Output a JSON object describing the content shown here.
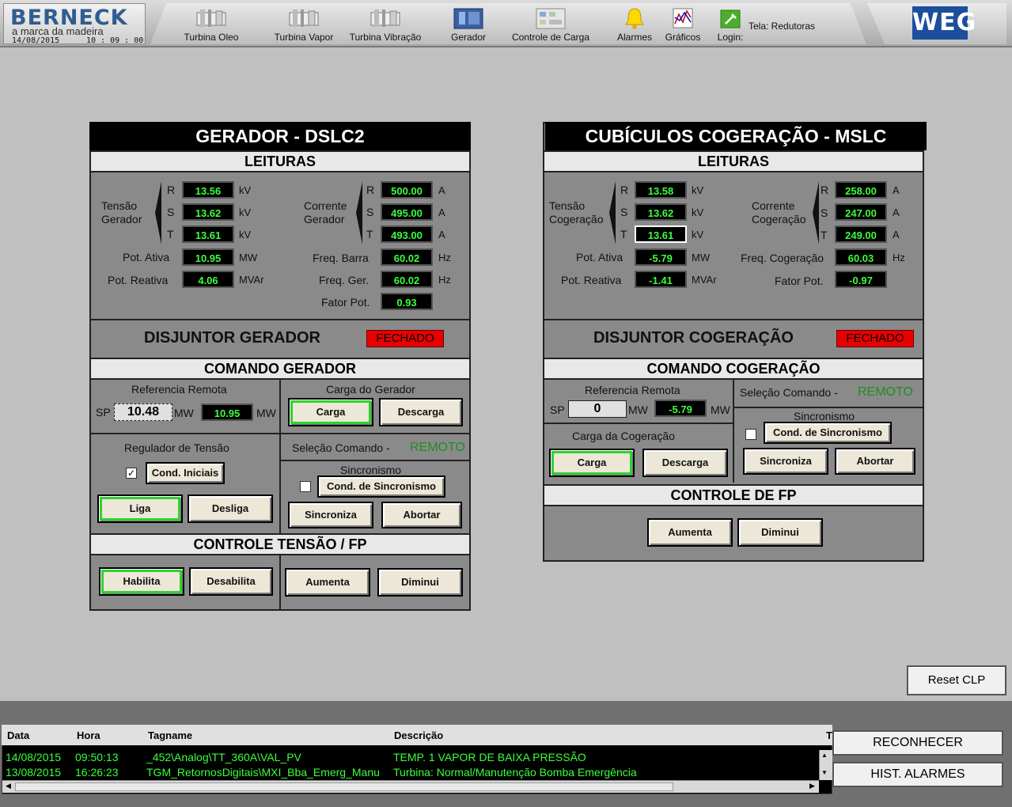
{
  "header": {
    "brand": "BERNECK",
    "tagline": "a marca da madeira",
    "date": "14/08/2015",
    "time": "10 : 09 : 00",
    "nav": [
      {
        "label": "Turbina Oleo",
        "icon": "turbine-icon"
      },
      {
        "label": "Turbina Vapor",
        "icon": "turbine-icon"
      },
      {
        "label": "Turbina Vibração",
        "icon": "turbine-icon"
      },
      {
        "label": "Gerador",
        "icon": "generator-icon"
      },
      {
        "label": "Controle de Carga",
        "icon": "load-control-icon"
      },
      {
        "label": "Alarmes",
        "icon": "bell-icon"
      },
      {
        "label": "Gráficos",
        "icon": "chart-icon"
      },
      {
        "label": "Login:",
        "icon": "login-icon"
      }
    ],
    "screen_label": "Tela: Redutoras",
    "logo": "WEG"
  },
  "gerador": {
    "title": "GERADOR - DSLC2",
    "leituras": "LEITURAS",
    "tensao_label": "Tensão\nGerador",
    "tensao": [
      {
        "phase": "R",
        "value": "13.56",
        "unit": "kV"
      },
      {
        "phase": "S",
        "value": "13.62",
        "unit": "kV"
      },
      {
        "phase": "T",
        "value": "13.61",
        "unit": "kV"
      }
    ],
    "corrente_label": "Corrente\nGerador",
    "corrente": [
      {
        "phase": "R",
        "value": "500.00",
        "unit": "A"
      },
      {
        "phase": "S",
        "value": "495.00",
        "unit": "A"
      },
      {
        "phase": "T",
        "value": "493.00",
        "unit": "A"
      }
    ],
    "pot_ativa": {
      "label": "Pot. Ativa",
      "value": "10.95",
      "unit": "MW"
    },
    "pot_reativa": {
      "label": "Pot. Reativa",
      "value": "4.06",
      "unit": "MVAr"
    },
    "freq_barra": {
      "label": "Freq. Barra",
      "value": "60.02",
      "unit": "Hz"
    },
    "freq_ger": {
      "label": "Freq. Ger.",
      "value": "60.02",
      "unit": "Hz"
    },
    "fator_pot": {
      "label": "Fator Pot.",
      "value": "0.93"
    },
    "disjuntor": "DISJUNTOR GERADOR",
    "disjuntor_status": "FECHADO",
    "comando": "COMANDO GERADOR",
    "ref_remota": "Referencia Remota",
    "sp_label": "SP",
    "sp_value": "10.48",
    "sp_unit": "MW",
    "ref_value": "10.95",
    "ref_unit": "MW",
    "carga_title": "Carga do Gerador",
    "carga": "Carga",
    "descarga": "Descarga",
    "regulador": "Regulador de Tensão",
    "cond_iniciais": "Cond. Iniciais",
    "cond_checked": "✓",
    "liga": "Liga",
    "desliga": "Desliga",
    "selecao": "Seleção Comando -",
    "selecao_value": "REMOTO",
    "sincronismo": "Sincronismo",
    "cond_sinc": "Cond. de Sincronismo",
    "sincroniza": "Sincroniza",
    "abortar": "Abortar",
    "controle": "CONTROLE TENSÃO / FP",
    "habilita": "Habilita",
    "desabilita": "Desabilita",
    "aumenta": "Aumenta",
    "diminui": "Diminui"
  },
  "cogeracao": {
    "title": "CUBÍCULOS COGERAÇÃO - MSLC",
    "leituras": "LEITURAS",
    "tensao_label": "Tensão\nCogeração",
    "tensao": [
      {
        "phase": "R",
        "value": "13.58",
        "unit": "kV"
      },
      {
        "phase": "S",
        "value": "13.62",
        "unit": "kV"
      },
      {
        "phase": "T",
        "value": "13.61",
        "unit": "kV"
      }
    ],
    "corrente_label": "Corrente\nCogeração",
    "corrente": [
      {
        "phase": "R",
        "value": "258.00",
        "unit": "A"
      },
      {
        "phase": "S",
        "value": "247.00",
        "unit": "A"
      },
      {
        "phase": "T",
        "value": "249.00",
        "unit": "A"
      }
    ],
    "pot_ativa": {
      "label": "Pot. Ativa",
      "value": "-5.79",
      "unit": "MW"
    },
    "pot_reativa": {
      "label": "Pot. Reativa",
      "value": "-1.41",
      "unit": "MVAr"
    },
    "freq": {
      "label": "Freq. Cogeração",
      "value": "60.03",
      "unit": "Hz"
    },
    "fator_pot": {
      "label": "Fator Pot.",
      "value": "-0.97"
    },
    "disjuntor": "DISJUNTOR COGERAÇÃO",
    "disjuntor_status": "FECHADO",
    "comando": "COMANDO COGERAÇÃO",
    "ref_remota": "Referencia Remota",
    "sp_label": "SP",
    "sp_value": "0",
    "sp_unit": "MW",
    "ref_value": "-5.79",
    "ref_unit": "MW",
    "selecao": "Seleção Comando -",
    "selecao_value": "REMOTO",
    "carga_title": "Carga da Cogeração",
    "carga": "Carga",
    "descarga": "Descarga",
    "sincronismo": "Sincronismo",
    "cond_sinc": "Cond. de Sincronismo",
    "sincroniza": "Sincroniza",
    "abortar": "Abortar",
    "controle": "CONTROLE DE FP",
    "aumenta": "Aumenta",
    "diminui": "Diminui"
  },
  "reset": "Reset CLP",
  "alarms": {
    "headers": [
      "Data",
      "Hora",
      "Tagname",
      "Descrição",
      "T"
    ],
    "rows": [
      [
        "14/08/2015",
        "09:50:13",
        "_452\\Analog\\TT_360A\\VAL_PV",
        "TEMP. 1 VAPOR DE BAIXA PRESSÃO"
      ],
      [
        "13/08/2015",
        "16:26:23",
        "TGM_RetornosDigitais\\MXI_Bba_Emerg_Manu",
        "Turbina: Normal/Manutenção Bomba Emergência"
      ]
    ],
    "reconhecer": "RECONHECER",
    "hist": "HIST. ALARMES"
  },
  "colors": {
    "display_bg": "#000000",
    "display_text": "#3cff3c",
    "fechado": "#e80000",
    "remoto": "#1e8f1e",
    "active_outline": "#2fd22f"
  }
}
